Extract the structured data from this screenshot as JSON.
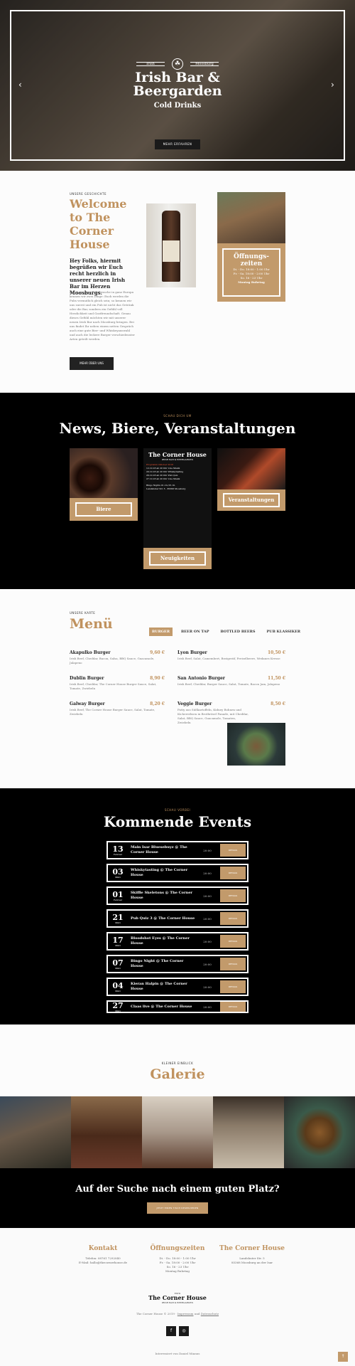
{
  "hero": {
    "brand_left": "Irish",
    "brand_right": "Moosburg",
    "title_line1": "Irish Bar &",
    "title_line2": "Beergarden",
    "subtitle": "Cold Drinks",
    "button": "MEHR ERFAHREN",
    "prev": "‹",
    "next": "›"
  },
  "welcome": {
    "eyebrow": "UNSERE GESCHICHTE",
    "title_line1": "Welcome",
    "title_line2": "to The",
    "title_line3": "Corner",
    "title_line4": "House",
    "lead": "Hey Folks, hiermit begrüßen wir Euch recht herzlich in unserer neuen Irish Bar im Herzen Moosburgs.",
    "body": "Durch zünftige Pub-Besuche in ganz Europa kennen wir zwei Dinge: Euch werden die Pubs vermutlich gleich sein; so kennen wir uns zuerst und ein Pub ist nicht das Getränk oder die Bar, sondern ein Gefühl voll Herzlichkeit und Gastfreundschaft. Genau dieses Gefühl möchten wir mit unserer neuen Irish Bar nach Moosburg bringen. Bei uns findet Ihr neben einem netten Gespräch auch eine gute Bier- und Whiskeyauswahl und auch die leckere Burger verschiedenster Arten geteilt werden.",
    "button": "MEHR ÜBER UNS",
    "hours_title_line1": "Öffnungs-",
    "hours_title_line2": "zeiten",
    "hours_1": "Di. - Do. 18:00 - 1:00 Uhr",
    "hours_2": "Fr. - Sa. 18:00 - 2:00 Uhr",
    "hours_3": "So. 16 - 23 Uhr",
    "hours_4": "Montag Ruhetag"
  },
  "news": {
    "eyebrow": "SCHAU DICH UM",
    "title": "News, Biere, Veranstaltungen",
    "card_beer": "Biere",
    "card_news": "Neuigkeiten",
    "card_events": "Veranstaltungen",
    "flyer_title": "The Corner House",
    "flyer_sub": "IRISH BAR & BEERGARDEN",
    "flyer_red": "Programm Oktober 2018",
    "flyer_lines": [
      "12.10.18 ab 20 Uhr Live Musik",
      "20.10.18 ab 20 Uhr Whiskytasting",
      "26.10.18 ab 20 Uhr Pub Quiz",
      "27.10.18 ab 20 Uhr Live Musik"
    ],
    "flyer_footer": "Bingo Nights 01.10./15.10.",
    "flyer_addr": "Landshuter Str. 5 · 85368 Moosburg"
  },
  "menu": {
    "eyebrow": "UNSERE KARTE",
    "title": "Menü",
    "tabs": [
      "BURGER",
      "BEER ON TAP",
      "BOTTLED BEERS",
      "PUB KLASSIKER"
    ],
    "items": [
      {
        "name": "Akapulko Burger",
        "price": "9,60 €",
        "desc": "Irish Beef, Cheddar, Bacon, Salsa, BBQ Sauce, Guacamole, Jalapeno"
      },
      {
        "name": "Lyon Burger",
        "price": "10,50 €",
        "desc": "Irish Beef, Salat, Camembert, Bratgeräf, Preiselbeere, Wedanes Kresse"
      },
      {
        "name": "Dublin Burger",
        "price": "8,90 €",
        "desc": "Irish Beef, Cheddar, The Corner House Burger Sauce, Salat, Tomate, Zwiebeln"
      },
      {
        "name": "San Antonio Burger",
        "price": "11,50 €",
        "desc": "Irish Beef, Cheddar, Burger Sauce, Salat, Tomate, Bacon Jam, Jalapeno"
      },
      {
        "name": "Galway Burger",
        "price": "8,20 €",
        "desc": "Irish Beef, The Corner House Burger Sauce, Salat, Tomate, Zwiebeln"
      },
      {
        "name": "Veggie Burger",
        "price": "8,50 €",
        "desc": "Patty aus Süßkartoffeln, Kidney Bohnen und Kichererbsen in Brotbrösel Panade, mit Cheddar, Salat, BBQ Sauce, Guacamole, Tomaten, Zwiebeln"
      }
    ]
  },
  "events": {
    "eyebrow": "SCHAU VORBEI",
    "title": "Kommende Events",
    "detail_label": "DETAILS",
    "rows": [
      {
        "day": "13",
        "month": "Februar",
        "title": "Main Isar Bluesebuyz @ The Corner House",
        "time": "20:00"
      },
      {
        "day": "03",
        "month": "März",
        "title": "Whiskytasting @ The Corner House",
        "time": "20:00"
      },
      {
        "day": "01",
        "month": "Februar",
        "title": "Skiffle Skeletons @ The Corner House",
        "time": "20:00"
      },
      {
        "day": "21",
        "month": "März",
        "title": "Pub Quiz 3 @ The Corner House",
        "time": "20:00"
      },
      {
        "day": "17",
        "month": "März",
        "title": "Bloodshot Eyes @ The Corner House",
        "time": "20:00"
      },
      {
        "day": "07",
        "month": "März",
        "title": "Bingo Night @ The Corner House",
        "time": "20:00"
      },
      {
        "day": "04",
        "month": "März",
        "title": "Kieran Halpin @ The Corner House",
        "time": "20:00"
      },
      {
        "day": "27",
        "month": "März",
        "title": "Claas live @ The Corner House",
        "time": "20:00"
      }
    ]
  },
  "gallery": {
    "eyebrow": "KLEINER EINBLICK",
    "title": "Galerie"
  },
  "cta": {
    "title": "Auf der Suche nach einem guten Platz?",
    "button": "JETZT EINEN TISCH RESERVIEREN"
  },
  "footer": {
    "col1_title": "Kontakt",
    "col1_l1": "Telefon: 08761 7292040",
    "col1_l2": "E-Mail: hallo@thecornerhouse.de",
    "col2_title": "Öffnungszeiten",
    "col2_l1": "Di. - Do. 18:00 - 1:00 Uhr",
    "col2_l2": "Fr. - Sa. 18:00 - 2:00 Uhr",
    "col2_l3": "So. 16 - 23 Uhr",
    "col2_l4": "Montag Ruhetag",
    "col3_title": "The Corner House",
    "col3_l1": "Landshuter Str. 5",
    "col3_l2": "85368 Moosburg an der Isar",
    "logo_top": "ESTD",
    "logo_name": "The Corner House",
    "logo_sub": "IRISH BAR & BEERGARDEN",
    "copy_prefix": "The Corner House © 2019 ·",
    "impressum": "Impressum",
    "und": "und",
    "datenschutz": "Datenschutz",
    "social_fb": "f",
    "social_ig": "◎",
    "made": "Interessiert von Daniel Mianus",
    "up": "↑"
  },
  "colors": {
    "accent": "#c29a6b",
    "dark": "#000000"
  }
}
